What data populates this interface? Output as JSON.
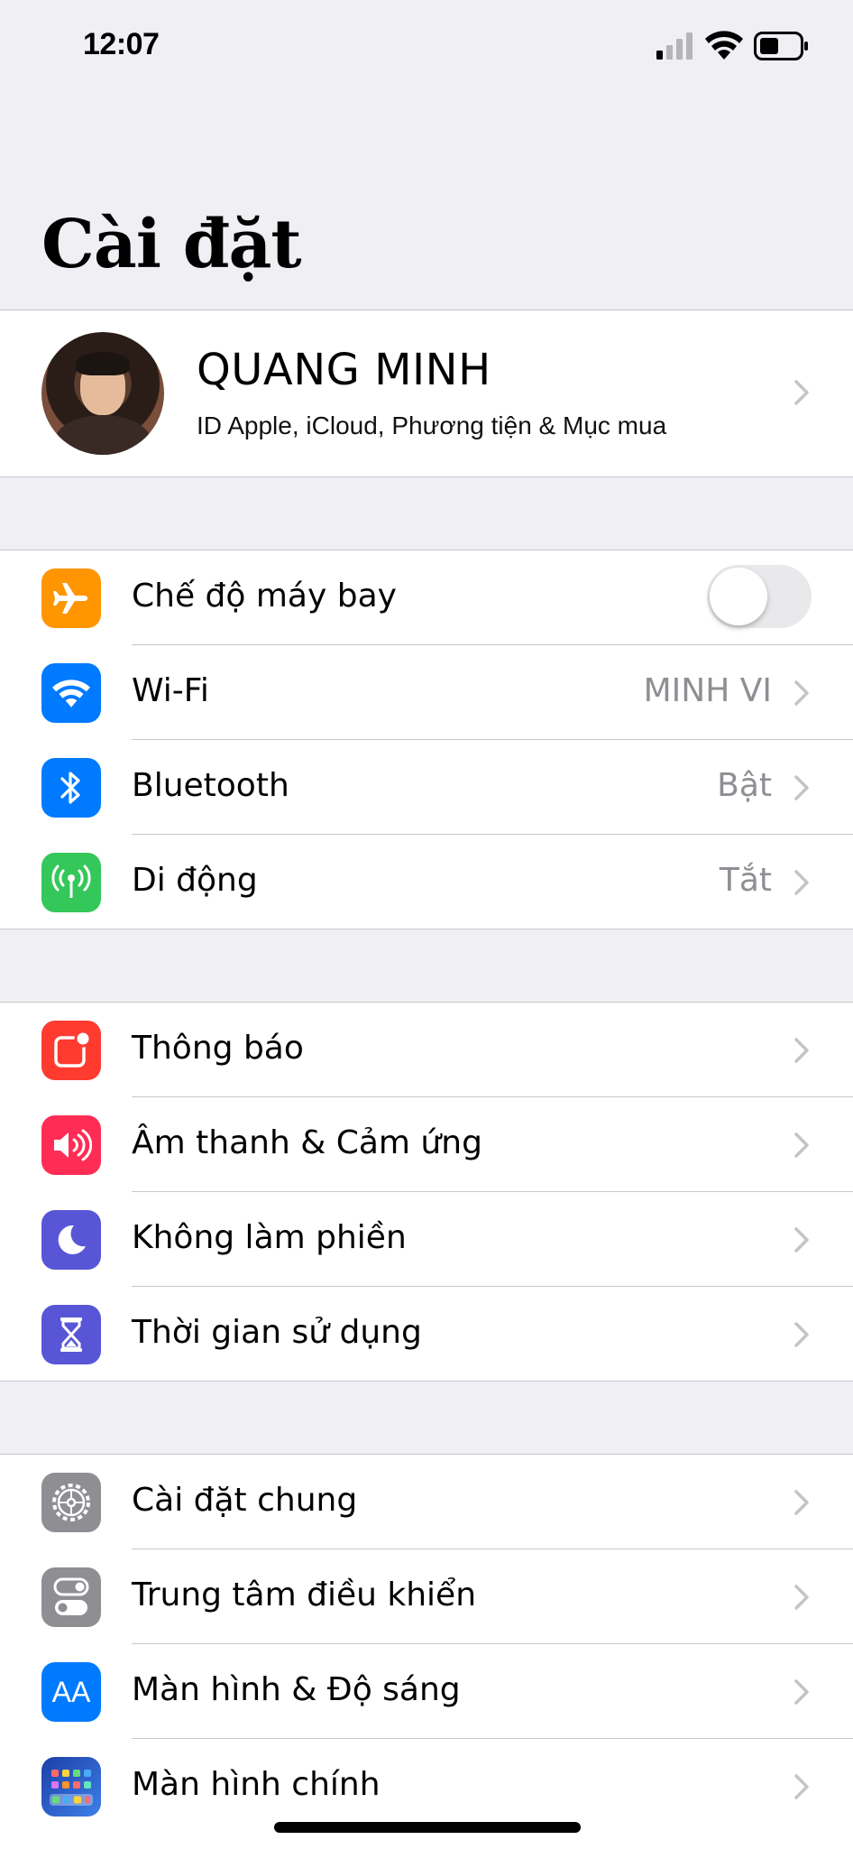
{
  "status": {
    "time": "12:07"
  },
  "title": "Cài đặt",
  "profile": {
    "name": "QUANG MINH",
    "subtitle": "ID Apple, iCloud, Phương tiện & Mục mua"
  },
  "groups": [
    [
      {
        "label": "Chế độ máy bay",
        "value": "",
        "icon": "airplane-icon",
        "color": "#ff9500",
        "toggle": false
      },
      {
        "label": "Wi-Fi",
        "value": "MINH VI",
        "icon": "wifi-icon",
        "color": "#007aff"
      },
      {
        "label": "Bluetooth",
        "value": "Bật",
        "icon": "bluetooth-icon",
        "color": "#007aff"
      },
      {
        "label": "Di động",
        "value": "Tắt",
        "icon": "cellular-icon",
        "color": "#34c759"
      }
    ],
    [
      {
        "label": "Thông báo",
        "icon": "notifications-icon",
        "color": "#ff3b30"
      },
      {
        "label": "Âm thanh & Cảm ứng",
        "icon": "sound-icon",
        "color": "#ff2d55"
      },
      {
        "label": "Không làm phiền",
        "icon": "moon-icon",
        "color": "#5856d6"
      },
      {
        "label": "Thời gian sử dụng",
        "icon": "hourglass-icon",
        "color": "#5856d6"
      }
    ],
    [
      {
        "label": "Cài đặt chung",
        "icon": "gear-icon",
        "color": "#8e8e93"
      },
      {
        "label": "Trung tâm điều khiển",
        "icon": "control-center-icon",
        "color": "#8e8e93"
      },
      {
        "label": "Màn hình & Độ sáng",
        "icon": "display-brightness-icon",
        "color": "#007aff",
        "icon_text": "AA"
      },
      {
        "label": "Màn hình chính",
        "icon": "home-screen-icon",
        "color": "#2c5fd7"
      }
    ]
  ]
}
